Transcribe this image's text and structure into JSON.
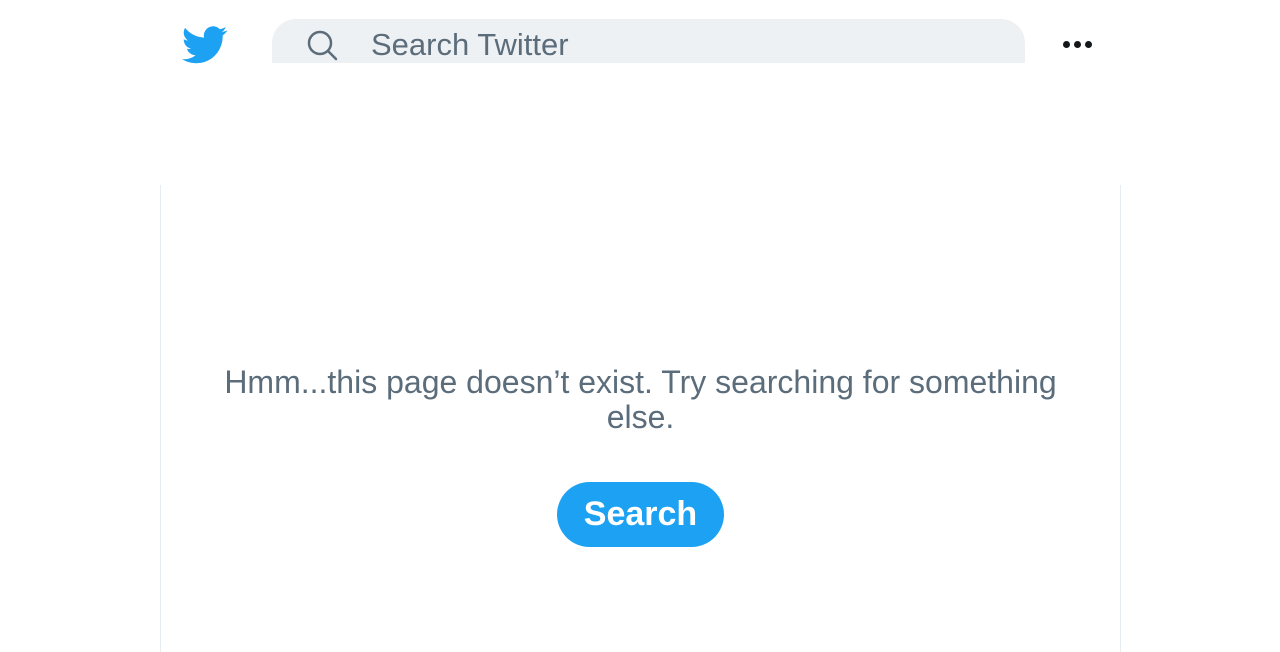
{
  "header": {
    "logo_icon": "twitter-bird-icon",
    "brand_color": "#1da1f2",
    "search": {
      "placeholder": "Search Twitter",
      "icon": "search-icon"
    },
    "more_icon": "more-dots-icon"
  },
  "main": {
    "message": "Hmm...this page doesn’t exist. Try searching for something else.",
    "search_button_label": "Search"
  }
}
